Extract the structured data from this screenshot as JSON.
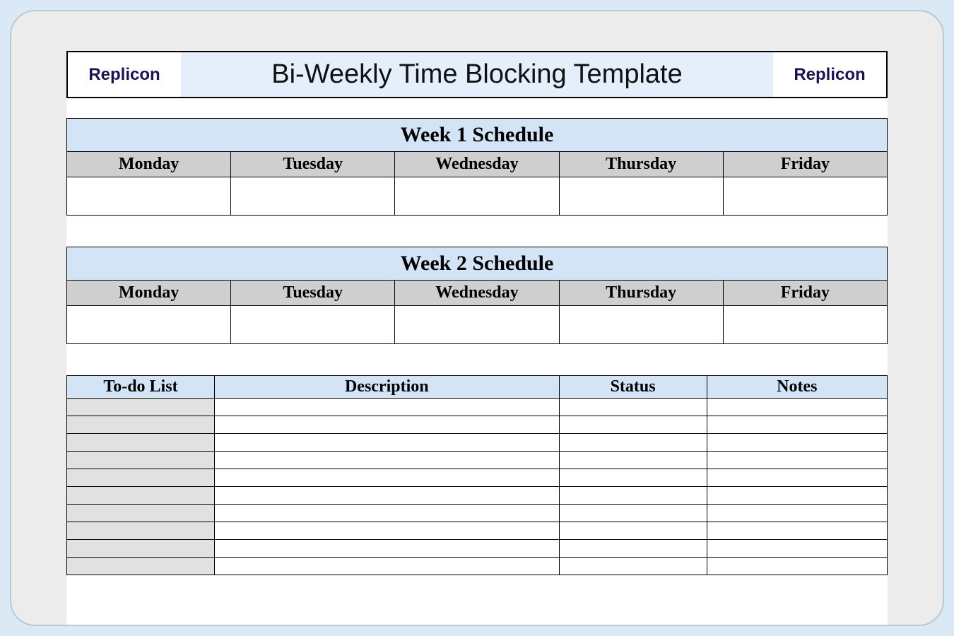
{
  "brand": "Replicon",
  "title": "Bi-Weekly Time Blocking Template",
  "week1": {
    "heading": "Week 1 Schedule",
    "days": [
      "Monday",
      "Tuesday",
      "Wednesday",
      "Thursday",
      "Friday"
    ]
  },
  "week2": {
    "heading": "Week 2 Schedule",
    "days": [
      "Monday",
      "Tuesday",
      "Wednesday",
      "Thursday",
      "Friday"
    ]
  },
  "todo": {
    "columns": [
      "To-do List",
      "Description",
      "Status",
      "Notes"
    ],
    "row_count": 10
  }
}
